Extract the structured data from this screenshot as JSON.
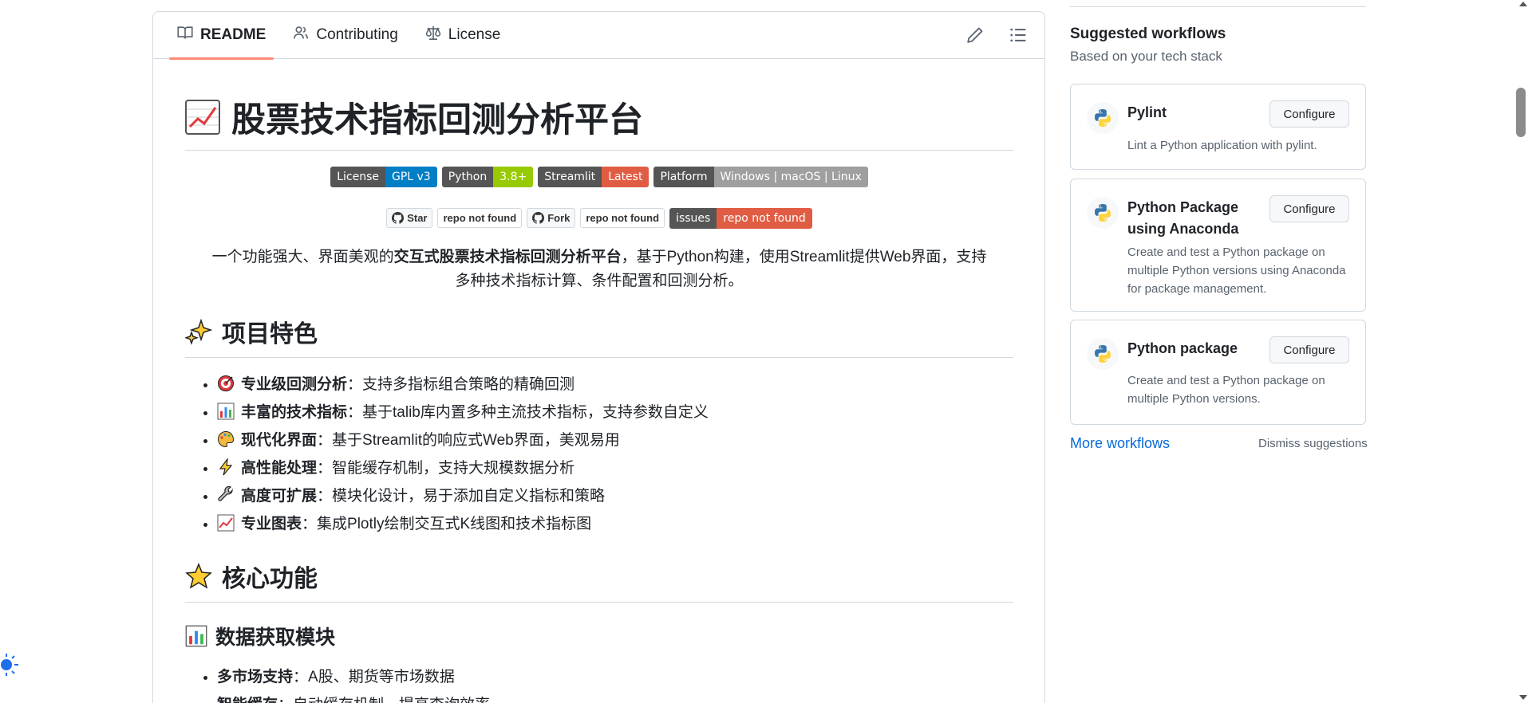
{
  "tabs": [
    {
      "label": "README",
      "icon": "book-icon",
      "active": true
    },
    {
      "label": "Contributing",
      "icon": "people-icon"
    },
    {
      "label": "License",
      "icon": "law-icon"
    }
  ],
  "tools": {
    "edit_icon": "pencil-icon",
    "toc_icon": "list-icon"
  },
  "readme": {
    "title": "股票技术指标回测分析平台",
    "badges": [
      {
        "left": "License",
        "right": "GPL v3",
        "color": "#007ec6"
      },
      {
        "left": "Python",
        "right": "3.8+",
        "color": "#97ca00"
      },
      {
        "left": "Streamlit",
        "right": "Latest",
        "color": "#e05d44"
      },
      {
        "left": "Platform",
        "right": "Windows | macOS | Linux",
        "color": "#9f9f9f"
      }
    ],
    "social": {
      "star_label": "Star",
      "star_count": "repo not found",
      "fork_label": "Fork",
      "fork_count": "repo not found",
      "issues_left": "issues",
      "issues_right": "repo not found"
    },
    "intro_pre": "一个功能强大、界面美观的",
    "intro_bold": "交互式股票技术指标回测分析平台",
    "intro_post": "，基于Python构建，使用Streamlit提供Web界面，支持",
    "intro_line2": "多种技术指标计算、条件配置和回测分析。",
    "section_features": "项目特色",
    "features": [
      {
        "icon": "target-icon",
        "bold": "专业级回测分析",
        "text": "：支持多指标组合策略的精确回测"
      },
      {
        "icon": "bar-chart-icon",
        "bold": "丰富的技术指标",
        "text": "：基于talib库内置多种主流技术指标，支持参数自定义"
      },
      {
        "icon": "palette-icon",
        "bold": "现代化界面",
        "text": "：基于Streamlit的响应式Web界面，美观易用"
      },
      {
        "icon": "lightning-icon",
        "bold": "高性能处理",
        "text": "：智能缓存机制，支持大规模数据分析"
      },
      {
        "icon": "wrench-icon",
        "bold": "高度可扩展",
        "text": "：模块化设计，易于添加自定义指标和策略"
      },
      {
        "icon": "chart-up-icon",
        "bold": "专业图表",
        "text": "：集成Plotly绘制交互式K线图和技术指标图"
      }
    ],
    "section_core": "核心功能",
    "sub_data": "数据获取模块",
    "data_items": [
      {
        "bold": "多市场支持",
        "text": "：A股、期货等市场数据"
      },
      {
        "bold": "智能缓存",
        "text": "：自动缓存机制，提高查询效率"
      }
    ]
  },
  "sidebar": {
    "title": "Suggested workflows",
    "subtitle": "Based on your tech stack",
    "workflows": [
      {
        "name": "Pylint",
        "desc": "Lint a Python application with pylint.",
        "button": "Configure"
      },
      {
        "name": "Python Package using Anaconda",
        "desc": "Create and test a Python package on multiple Python versions using Anaconda for package management.",
        "button": "Configure"
      },
      {
        "name": "Python package",
        "desc": "Create and test a Python package on multiple Python versions.",
        "button": "Configure"
      }
    ],
    "more": "More workflows",
    "dismiss": "Dismiss suggestions"
  }
}
